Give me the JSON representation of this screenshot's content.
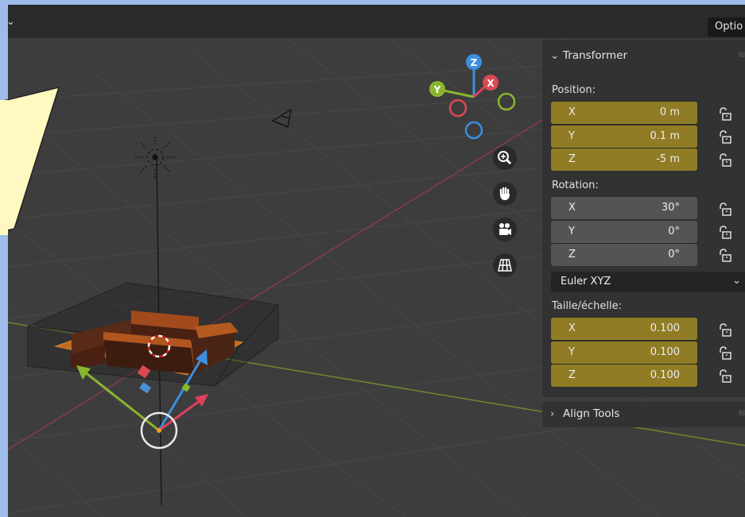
{
  "header": {
    "options_label": "Optio"
  },
  "gizmo": {
    "axis_x": "X",
    "axis_y": "Y",
    "axis_z": "Z"
  },
  "nav_buttons": [
    "zoom-icon",
    "hand-pan-icon",
    "camera-view-icon",
    "grid-ortho-icon"
  ],
  "transform_panel": {
    "title": "Transformer",
    "position_label": "Position:",
    "position": [
      {
        "axis": "X",
        "value": "0 m"
      },
      {
        "axis": "Y",
        "value": "0.1 m"
      },
      {
        "axis": "Z",
        "value": "-5 m"
      }
    ],
    "rotation_label": "Rotation:",
    "rotation": [
      {
        "axis": "X",
        "value": "30°"
      },
      {
        "axis": "Y",
        "value": "0°"
      },
      {
        "axis": "Z",
        "value": "0°"
      }
    ],
    "rotation_mode": "Euler XYZ",
    "scale_label": "Taille/échelle:",
    "scale": [
      {
        "axis": "X",
        "value": "0.100"
      },
      {
        "axis": "Y",
        "value": "0.100"
      },
      {
        "axis": "Z",
        "value": "0.100"
      }
    ]
  },
  "align_panel": {
    "title": "Align Tools"
  },
  "colors": {
    "viewport_bg": "#3d3d3d",
    "field_active": "#8f7c24",
    "field_inactive": "#545454",
    "axis_x": "#e0405a",
    "axis_y": "#8ab62e",
    "axis_z": "#3a8fe0",
    "callout_fill": "#fff8c0",
    "frame_bg": "#9dbcec"
  }
}
